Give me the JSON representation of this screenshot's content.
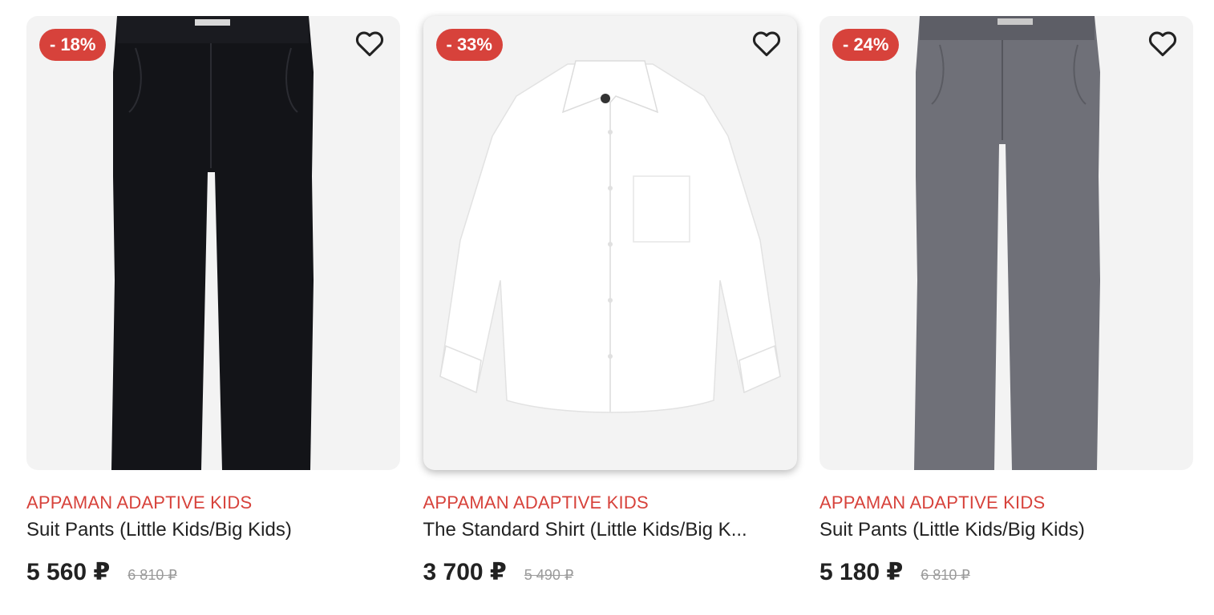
{
  "products": [
    {
      "discount": "- 18%",
      "brand": "APPAMAN ADAPTIVE KIDS",
      "name": "Suit Pants (Little Kids/Big Kids)",
      "price": "5 560 ₽",
      "old_price": "6 810 ₽",
      "image": "black-suit-pants",
      "color": "#131418"
    },
    {
      "discount": "- 33%",
      "brand": "APPAMAN ADAPTIVE KIDS",
      "name": "The Standard Shirt (Little Kids/Big K...",
      "price": "3 700 ₽",
      "old_price": "5 490 ₽",
      "image": "white-dress-shirt",
      "color": "#ffffff"
    },
    {
      "discount": "- 24%",
      "brand": "APPAMAN ADAPTIVE KIDS",
      "name": "Suit Pants (Little Kids/Big Kids)",
      "price": "5 180 ₽",
      "old_price": "6 810 ₽",
      "image": "grey-suit-pants",
      "color": "#6f7078"
    }
  ],
  "icons": {
    "favorite": "heart-outline-icon"
  },
  "colors": {
    "accent": "#d7423b",
    "image_bg": "#f3f3f3"
  }
}
